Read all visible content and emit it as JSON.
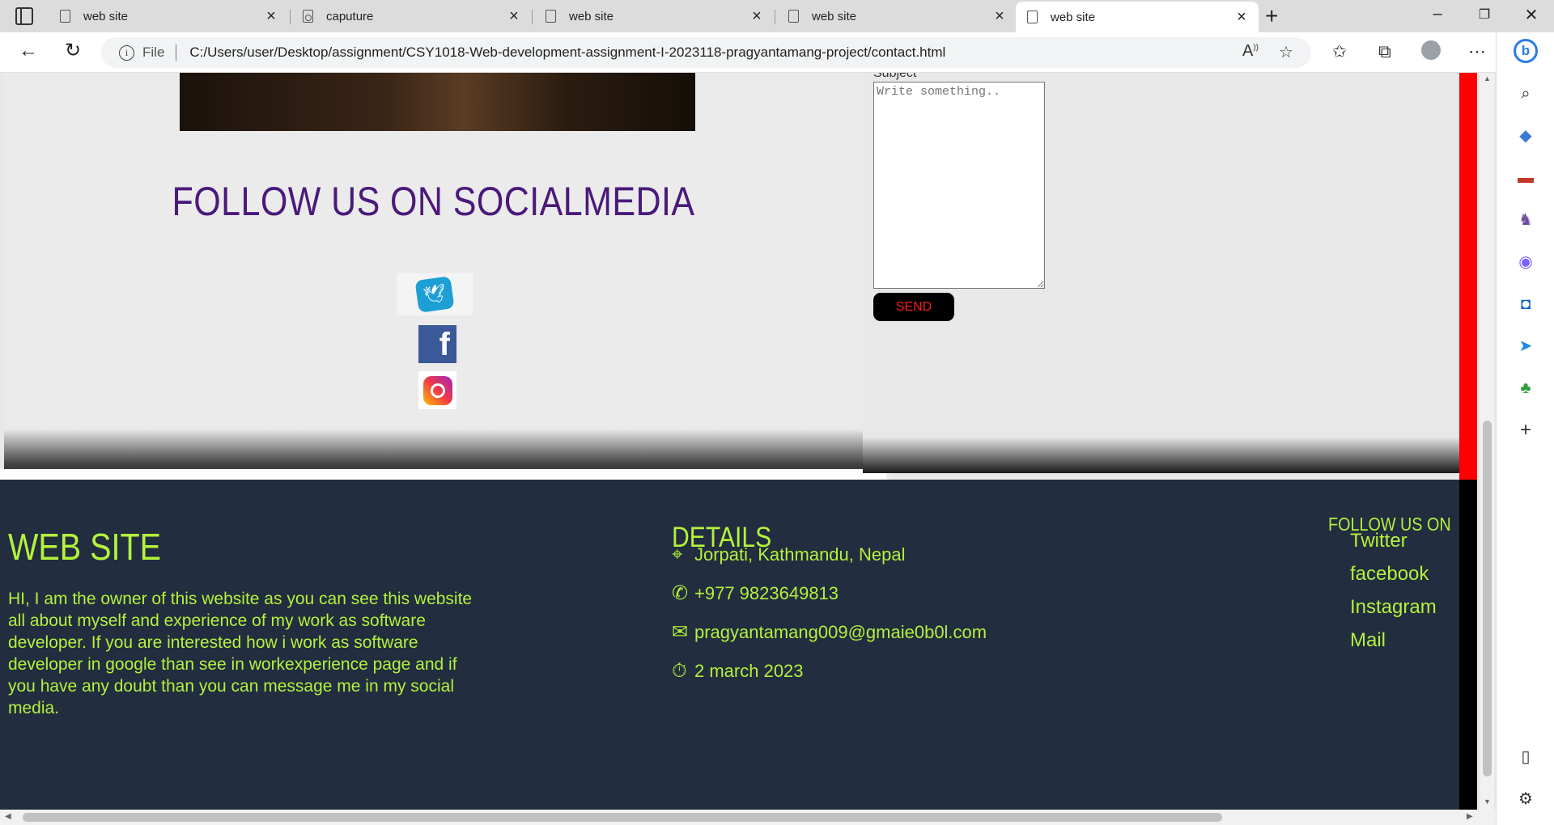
{
  "tabs": [
    {
      "title": "web site",
      "icon": "document-icon"
    },
    {
      "title": "caputure",
      "icon": "screenshot-icon"
    },
    {
      "title": "web site",
      "icon": "document-icon"
    },
    {
      "title": "web site",
      "icon": "document-icon"
    },
    {
      "title": "web site",
      "icon": "document-icon",
      "active": true
    }
  ],
  "address": {
    "scheme": "File",
    "url": "C:/Users/user/Desktop/assignment/CSY1018-Web-development-assignment-I-2023118-pragyantamang-project/contact.html"
  },
  "page": {
    "social_title": "FOLLOW US ON SOCIALMEDIA",
    "social_icons": [
      "twitter-icon",
      "facebook-icon",
      "instagram-icon"
    ],
    "form": {
      "subject_label": "Subject",
      "subject_placeholder": "Write something..",
      "send_label": "SEND"
    }
  },
  "footer": {
    "brand": "WEB SITE",
    "about": "HI, I am the owner of this website as you can see this website all about myself and experience of my work as software developer. If you are interested how i work as software developer in google than see in workexperience page and if you have any doubt than you can message me in my social media.",
    "details_title": "DETAILS",
    "address": "Jorpati, Kathmandu, Nepal",
    "phone": "+977 9823649813",
    "email": "pragyantamang009@gmaie0b0l.com",
    "date": "2 march 2023",
    "follow_title": "FOLLOW US ON",
    "links": [
      "Twitter",
      "facebook",
      "Instagram",
      "Mail"
    ]
  },
  "colors": {
    "footer_bg": "#222d3f",
    "footer_text": "#b4f23c",
    "social_title": "#4a1a7a",
    "send_text": "#ff1a1a"
  }
}
